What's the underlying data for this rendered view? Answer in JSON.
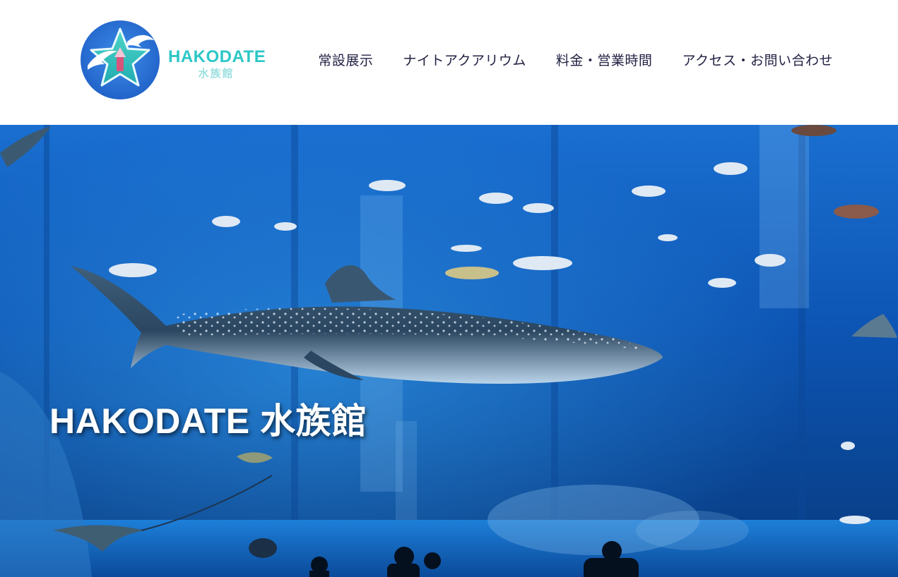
{
  "brand": {
    "name_en": "HAKODATE",
    "name_ja": "水族館"
  },
  "nav": {
    "items": [
      {
        "label": "常設展示"
      },
      {
        "label": "ナイトアクアリウム"
      },
      {
        "label": "料金・営業時間"
      },
      {
        "label": "アクセス・お問い合わせ"
      }
    ]
  },
  "hero": {
    "title": "HAKODATE 水族館"
  },
  "colors": {
    "brand_teal": "#2cc7c7",
    "logo_blue": "#2a6fd0",
    "nav_text": "#222244",
    "water": "#0a3f8a"
  }
}
